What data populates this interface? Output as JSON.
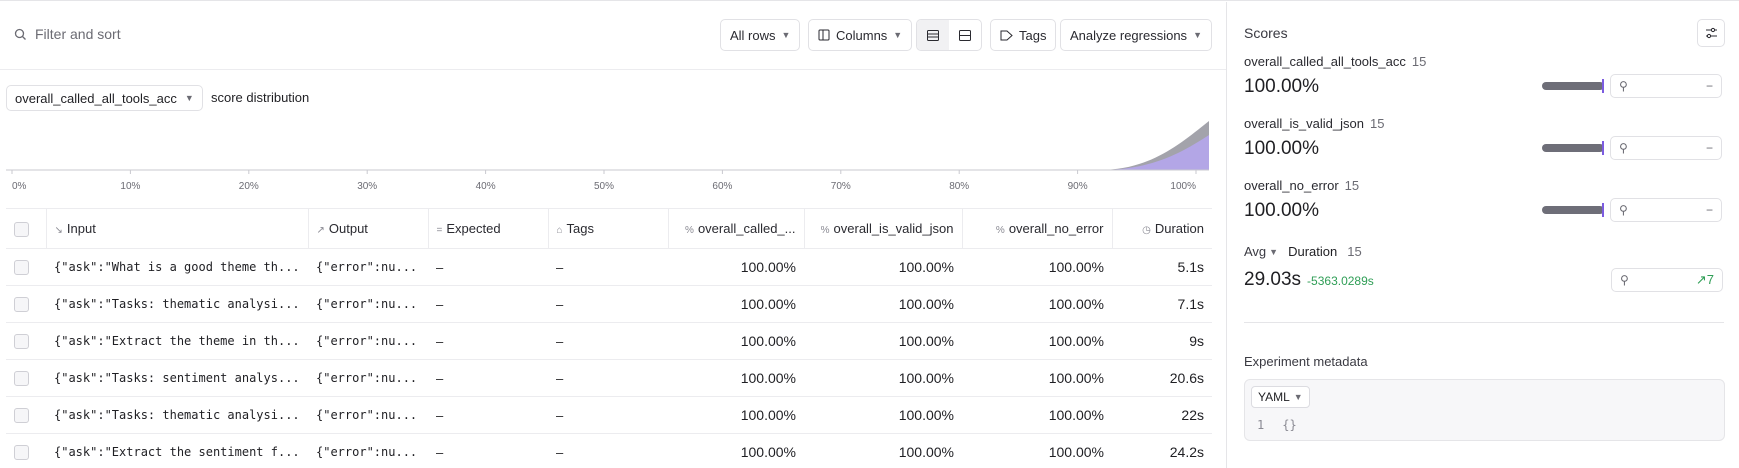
{
  "toolbar": {
    "filter_placeholder": "Filter and sort",
    "all_rows": "All rows",
    "columns": "Columns",
    "tags": "Tags",
    "analyze": "Analyze regressions"
  },
  "distribution": {
    "selected_score": "overall_called_all_tools_acc",
    "label": "score distribution",
    "ticks": [
      "0%",
      "10%",
      "20%",
      "30%",
      "40%",
      "50%",
      "60%",
      "70%",
      "80%",
      "90%",
      "100%"
    ]
  },
  "table": {
    "headers": [
      "Input",
      "Output",
      "Expected",
      "Tags",
      "overall_called_...",
      "overall_is_valid_json",
      "overall_no_error",
      "Duration"
    ],
    "rows": [
      {
        "input": "{\"ask\":\"What is a good theme th...",
        "output": "{\"error\":nu...",
        "expected": "–",
        "tags": "–",
        "c1": "100.00%",
        "c2": "100.00%",
        "c3": "100.00%",
        "dur": "5.1s"
      },
      {
        "input": "{\"ask\":\"Tasks: thematic analysi...",
        "output": "{\"error\":nu...",
        "expected": "–",
        "tags": "–",
        "c1": "100.00%",
        "c2": "100.00%",
        "c3": "100.00%",
        "dur": "7.1s"
      },
      {
        "input": "{\"ask\":\"Extract the theme in th...",
        "output": "{\"error\":nu...",
        "expected": "–",
        "tags": "–",
        "c1": "100.00%",
        "c2": "100.00%",
        "c3": "100.00%",
        "dur": "9s"
      },
      {
        "input": "{\"ask\":\"Tasks: sentiment analys...",
        "output": "{\"error\":nu...",
        "expected": "–",
        "tags": "–",
        "c1": "100.00%",
        "c2": "100.00%",
        "c3": "100.00%",
        "dur": "20.6s"
      },
      {
        "input": "{\"ask\":\"Tasks: thematic analysi...",
        "output": "{\"error\":nu...",
        "expected": "–",
        "tags": "–",
        "c1": "100.00%",
        "c2": "100.00%",
        "c3": "100.00%",
        "dur": "22s"
      },
      {
        "input": "{\"ask\":\"Extract the sentiment f...",
        "output": "{\"error\":nu...",
        "expected": "–",
        "tags": "–",
        "c1": "100.00%",
        "c2": "100.00%",
        "c3": "100.00%",
        "dur": "24.2s"
      }
    ]
  },
  "scores": {
    "title": "Scores",
    "items": [
      {
        "name": "overall_called_all_tools_acc",
        "count": "15",
        "value": "100.00%",
        "fill": 1.0
      },
      {
        "name": "overall_is_valid_json",
        "count": "15",
        "value": "100.00%",
        "fill": 1.0
      },
      {
        "name": "overall_no_error",
        "count": "15",
        "value": "100.00%",
        "fill": 1.0
      }
    ],
    "duration": {
      "agg": "Avg",
      "name": "Duration",
      "count": "15",
      "value": "29.03s",
      "delta": "-5363.0289s",
      "improvements": "7"
    }
  },
  "metadata": {
    "title": "Experiment metadata",
    "format": "YAML",
    "line_no": "1",
    "content": "{}"
  },
  "colors": {
    "accent": "#7c5ce0",
    "positive": "#2f9e56",
    "dist_primary": "#b3a6e6",
    "dist_secondary": "#a3a3ab"
  }
}
